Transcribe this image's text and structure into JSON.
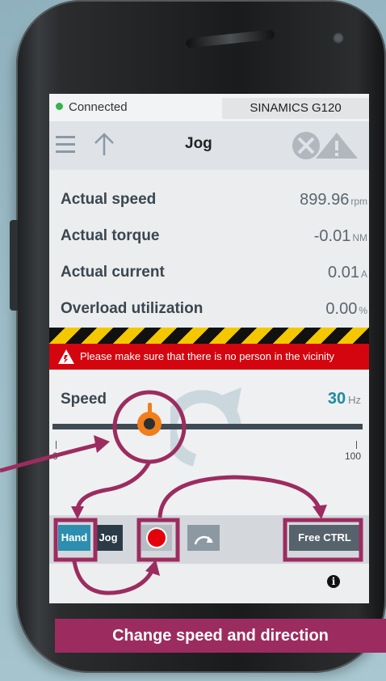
{
  "status": {
    "connection_text": "Connected",
    "device_name": "SINAMICS G120"
  },
  "header": {
    "title": "Jog"
  },
  "values": [
    {
      "label": "Actual speed",
      "value": "899.96",
      "unit": "rpm"
    },
    {
      "label": "Actual torque",
      "value": "-0.01",
      "unit": "NM"
    },
    {
      "label": "Actual current",
      "value": "0.01",
      "unit": "A"
    },
    {
      "label": "Overload utilization",
      "value": "0.00",
      "unit": "%"
    }
  ],
  "warning": {
    "text": "Please make sure that there is no person in the vicinity"
  },
  "speed": {
    "label": "Speed",
    "value": "30",
    "unit": "Hz",
    "min": "0",
    "max": "100",
    "level": 0.3
  },
  "controls": {
    "hand_label": "Hand",
    "jog_label": "Jog",
    "free_ctrl_label": "Free CTRL"
  },
  "caption": "Change speed and direction",
  "colors": {
    "accent_blue": "#2c8fb0",
    "warning_red": "#d4050f",
    "slider_knob": "#f07e1c",
    "annotation": "#9c2c5f"
  },
  "icons": [
    "menu-icon",
    "arrow-up-icon",
    "alarm-icon",
    "warning-triangle-icon",
    "warning-icon",
    "rotation-direction-icon",
    "record-icon",
    "info-icon"
  ]
}
